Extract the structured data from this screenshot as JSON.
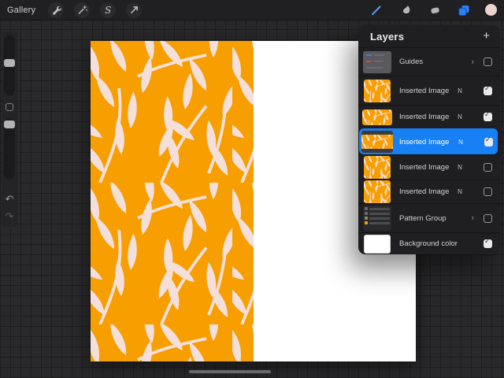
{
  "toolbar": {
    "gallery_label": "Gallery",
    "left_icons": [
      "actions-wrench-icon",
      "adjustments-wand-icon",
      "selections-s-icon",
      "transform-arrow-icon"
    ],
    "selections_glyph": "S",
    "right_icons": [
      "brush-icon",
      "smudge-icon",
      "eraser-icon",
      "layers-icon",
      "color-swatch"
    ],
    "accent_blue": "#2e7cf6",
    "color_swatch": "#ecd4cd"
  },
  "sidebar": {
    "controls": [
      "brush-size-slider",
      "modify-button",
      "opacity-slider",
      "undo-button",
      "redo-button"
    ],
    "undo_glyph": "↶",
    "redo_glyph": "↷"
  },
  "layers_panel": {
    "title": "Layers",
    "add_button_glyph": "+",
    "selected_color": "#1780f4",
    "chevron_glyph": "›",
    "rows": [
      {
        "label": "Guides",
        "thumb": "guides",
        "chevron": true,
        "blend": "",
        "checked": false,
        "selected": false
      },
      {
        "label": "Inserted Image",
        "thumb": "pattern-square",
        "chevron": false,
        "blend": "N",
        "checked": true,
        "selected": false
      },
      {
        "label": "Inserted Image",
        "thumb": "pattern-wide",
        "chevron": false,
        "blend": "N",
        "checked": true,
        "selected": false
      },
      {
        "label": "Inserted Image",
        "thumb": "pattern-framed",
        "chevron": false,
        "blend": "N",
        "checked": true,
        "selected": true
      },
      {
        "label": "Inserted Image",
        "thumb": "pattern-square",
        "chevron": false,
        "blend": "N",
        "checked": false,
        "selected": false
      },
      {
        "label": "Inserted Image",
        "thumb": "pattern-square",
        "chevron": false,
        "blend": "N",
        "checked": false,
        "selected": false
      },
      {
        "label": "Pattern Group",
        "thumb": "group",
        "chevron": true,
        "blend": "",
        "checked": false,
        "selected": false
      },
      {
        "label": "Background color",
        "thumb": "white",
        "chevron": false,
        "blend": "",
        "checked": true,
        "selected": false
      }
    ]
  },
  "canvas": {
    "pattern_orange": "#f79e00",
    "pattern_leaf": "#f5dfda",
    "background": "#ffffff"
  }
}
